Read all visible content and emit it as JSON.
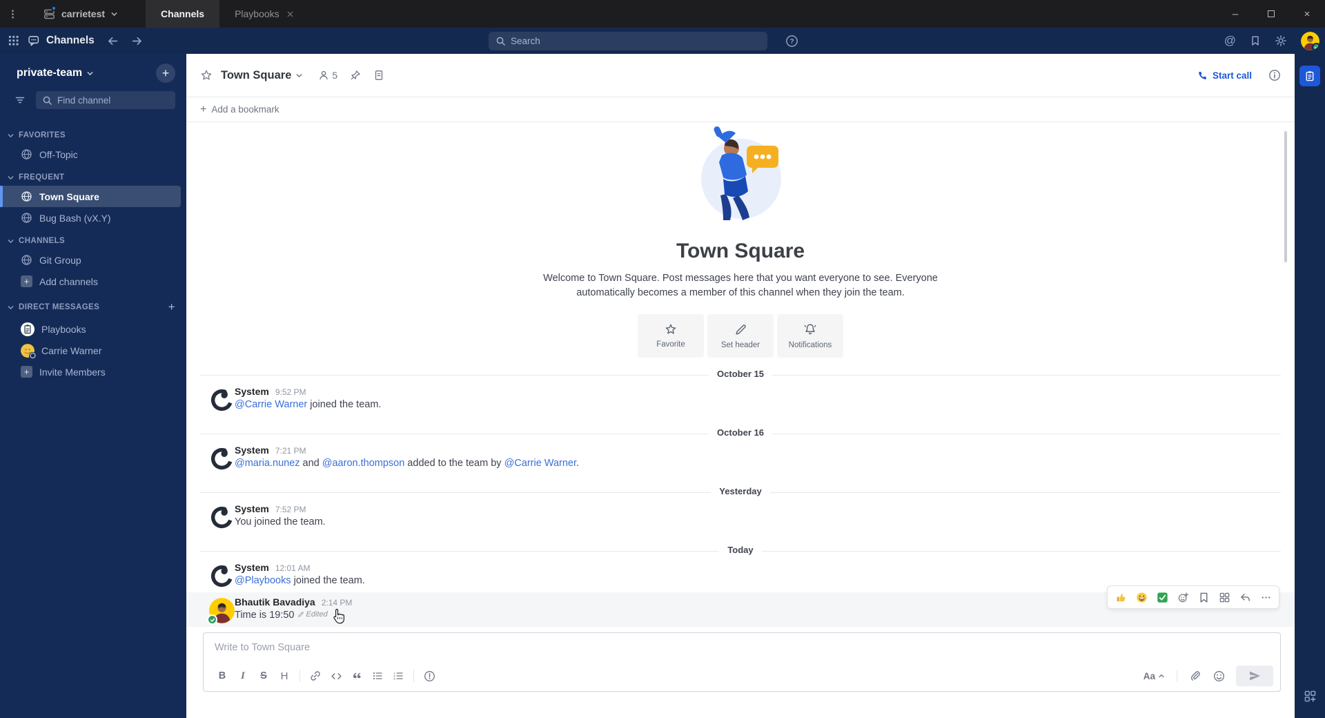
{
  "window": {
    "server_name": "carrietest",
    "tabs": [
      {
        "label": "Channels",
        "active": true,
        "closable": false
      },
      {
        "label": "Playbooks",
        "active": false,
        "closable": true
      }
    ],
    "controls": [
      "minimize",
      "maximize",
      "close"
    ]
  },
  "app_bar": {
    "product_title": "Channels",
    "search_placeholder": "Search",
    "right_icons": [
      "at-mentions",
      "saved-posts",
      "settings",
      "user-avatar"
    ]
  },
  "sidebar": {
    "team_name": "private-team",
    "add_button": "+",
    "find_channel_placeholder": "Find channel",
    "sections": [
      {
        "label": "FAVORITES",
        "has_add": false,
        "items": [
          {
            "label": "Off-Topic",
            "icon": "globe"
          }
        ]
      },
      {
        "label": "FREQUENT",
        "has_add": false,
        "items": [
          {
            "label": "Town Square",
            "icon": "globe",
            "selected": true
          },
          {
            "label": "Bug Bash (vX.Y)",
            "icon": "globe"
          }
        ]
      },
      {
        "label": "CHANNELS",
        "has_add": false,
        "items": [
          {
            "label": "Git Group",
            "icon": "globe"
          },
          {
            "label": "Add channels",
            "icon": "plus-box"
          }
        ]
      },
      {
        "label": "DIRECT MESSAGES",
        "has_add": true,
        "items": [
          {
            "label": "Playbooks",
            "icon": "playbooks-avatar"
          },
          {
            "label": "Carrie Warner",
            "icon": "carrie-avatar"
          },
          {
            "label": "Invite Members",
            "icon": "plus-box"
          }
        ]
      }
    ]
  },
  "channel_header": {
    "name": "Town Square",
    "member_count": "5",
    "start_call_label": "Start call",
    "bookmark_label": "Add a bookmark",
    "bookmark_plus": "+"
  },
  "intro": {
    "title": "Town Square",
    "description": "Welcome to Town Square. Post messages here that you want everyone to see. Everyone automatically becomes a member of this channel when they join the team.",
    "actions": [
      {
        "label": "Favorite",
        "icon": "star"
      },
      {
        "label": "Set header",
        "icon": "pencil"
      },
      {
        "label": "Notifications",
        "icon": "bell"
      }
    ]
  },
  "feed": [
    {
      "type": "divider",
      "label": "October 15"
    },
    {
      "type": "message",
      "author": "System",
      "avatar": "mattermost-logo",
      "time": "9:52 PM",
      "parts": [
        {
          "t": "@Carrie Warner",
          "link": true
        },
        {
          "t": " joined the team."
        }
      ]
    },
    {
      "type": "divider",
      "label": "October 16"
    },
    {
      "type": "message",
      "author": "System",
      "avatar": "mattermost-logo",
      "time": "7:21 PM",
      "parts": [
        {
          "t": "@maria.nunez",
          "link": true
        },
        {
          "t": " and "
        },
        {
          "t": "@aaron.thompson",
          "link": true
        },
        {
          "t": " added to the team by "
        },
        {
          "t": "@Carrie Warner",
          "link": true
        },
        {
          "t": "."
        }
      ]
    },
    {
      "type": "divider",
      "label": "Yesterday"
    },
    {
      "type": "message",
      "author": "System",
      "avatar": "mattermost-logo",
      "time": "7:52 PM",
      "parts": [
        {
          "t": "You joined the team."
        }
      ]
    },
    {
      "type": "divider",
      "label": "Today"
    },
    {
      "type": "message",
      "author": "System",
      "avatar": "mattermost-logo",
      "time": "12:01 AM",
      "parts": [
        {
          "t": "@Playbooks",
          "link": true
        },
        {
          "t": " joined the team."
        }
      ]
    },
    {
      "type": "message",
      "author": "Bhautik Bavadiya",
      "avatar": "photo-avatar",
      "time": "2:14 PM",
      "parts": [
        {
          "t": "Time is 19:50"
        }
      ],
      "edited_label": "Edited",
      "hovered": true,
      "status": "online"
    }
  ],
  "message_hover_toolbar": {
    "quick_reactions": [
      "thumbs-up-emoji",
      "grinning-emoji",
      "check-emoji"
    ],
    "actions": [
      "add-reaction",
      "save-message",
      "message-actions",
      "reply",
      "more-actions"
    ]
  },
  "composer": {
    "placeholder": "Write to Town Square",
    "formatting": [
      "bold",
      "italic",
      "strikethrough",
      "heading",
      "sep",
      "link",
      "code",
      "quote",
      "bulleted-list",
      "numbered-list",
      "sep",
      "priority"
    ],
    "format_toggle_label": "Aa",
    "right_tools": [
      "attach",
      "emoji"
    ],
    "send": "send"
  },
  "right_strip": {
    "top": "playbooks-active",
    "bottom": "apps-grid"
  },
  "colors": {
    "accent": "#1c58d9",
    "link": "#3b6fd6",
    "online": "#2f9e64",
    "sidebar_selected_bar": "#6095f1"
  }
}
